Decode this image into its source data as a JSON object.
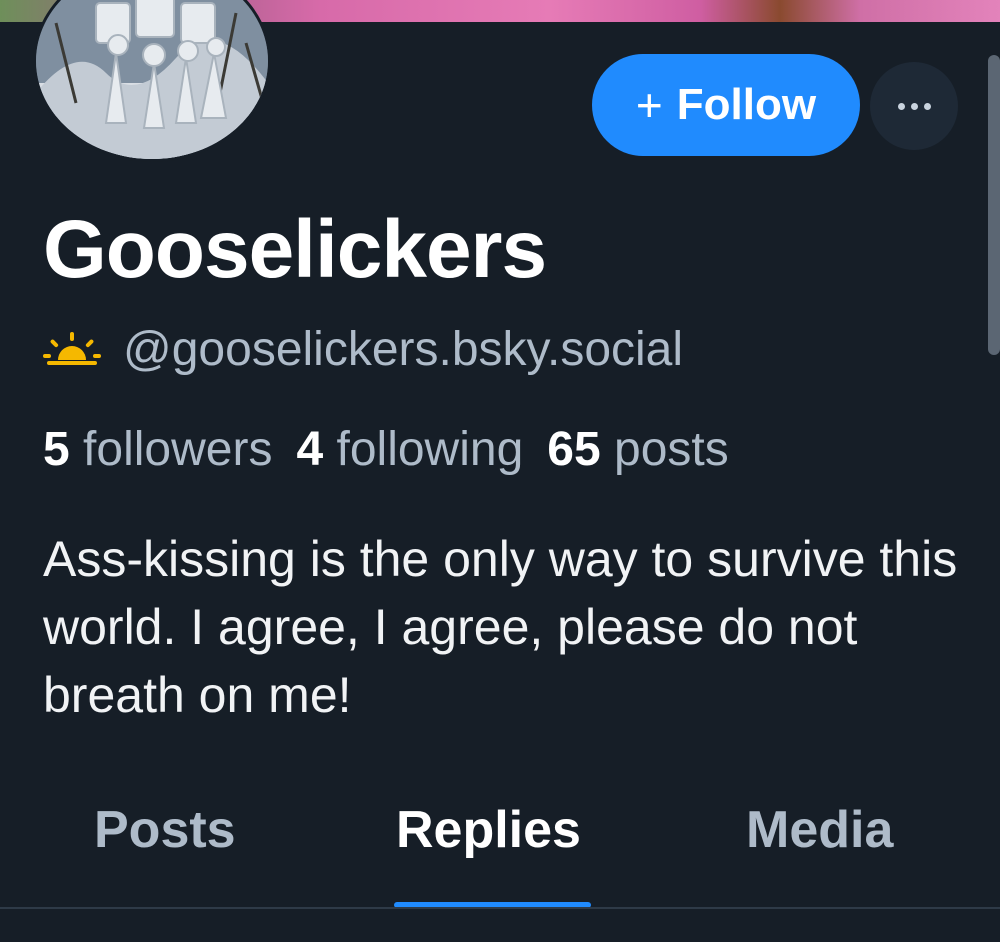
{
  "profile": {
    "display_name": "Gooselickers",
    "handle": "@gooselickers.bsky.social",
    "status_icon": "sun-icon",
    "bio": "Ass-kissing is the only way to survive this world. I agree, I agree, please do not breath on me!"
  },
  "stats": {
    "followers_count": "5",
    "followers_label": "followers",
    "following_count": "4",
    "following_label": "following",
    "posts_count": "65",
    "posts_label": "posts"
  },
  "actions": {
    "follow_plus": "+",
    "follow_label": "Follow",
    "more_icon": "more-horizontal-icon"
  },
  "tabs": [
    {
      "label": "Posts",
      "active": false
    },
    {
      "label": "Replies",
      "active": true
    },
    {
      "label": "Media",
      "active": false
    }
  ],
  "colors": {
    "background": "#161e27",
    "accent": "#208bfe",
    "muted_text": "#aebbc9",
    "sun_icon": "#f5b800"
  }
}
